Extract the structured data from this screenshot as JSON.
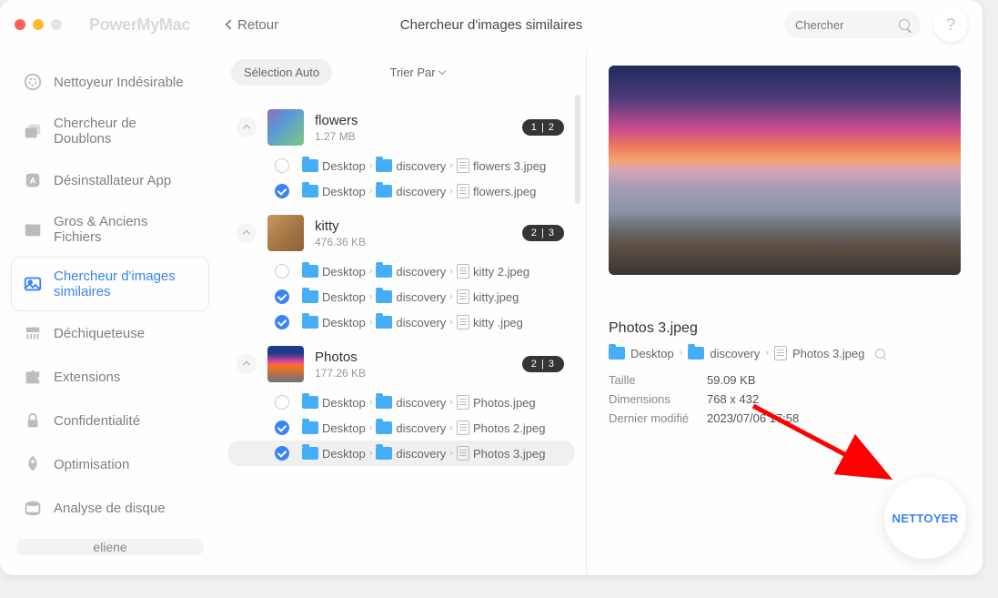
{
  "app_name": "PowerMyMac",
  "back_label": "Retour",
  "page_title": "Chercheur d'images similaires",
  "search_placeholder": "Chercher",
  "help_label": "?",
  "sidebar": {
    "items": [
      {
        "label": "Nettoyeur Indésirable"
      },
      {
        "label": "Chercheur de Doublons"
      },
      {
        "label": "Désinstallateur App"
      },
      {
        "label": "Gros & Anciens Fichiers"
      },
      {
        "label": "Chercheur d'images similaires"
      },
      {
        "label": "Déchiqueteuse"
      },
      {
        "label": "Extensions"
      },
      {
        "label": "Confidentialité"
      },
      {
        "label": "Optimisation"
      },
      {
        "label": "Analyse de disque"
      }
    ],
    "user": "eliene"
  },
  "toolbar": {
    "auto_select": "Sélection Auto",
    "sort": "Trier Par"
  },
  "path_labels": {
    "desktop": "Desktop",
    "discovery": "discovery"
  },
  "groups": [
    {
      "name": "flowers",
      "size": "1.27 MB",
      "badge": "1 | 2",
      "files": [
        {
          "checked": false,
          "name": "flowers 3.jpeg"
        },
        {
          "checked": true,
          "name": "flowers.jpeg"
        }
      ]
    },
    {
      "name": "kitty",
      "size": "476.36 KB",
      "badge": "2 | 3",
      "files": [
        {
          "checked": false,
          "name": "kitty 2.jpeg"
        },
        {
          "checked": true,
          "name": "kitty.jpeg"
        },
        {
          "checked": true,
          "name": "kitty .jpeg"
        }
      ]
    },
    {
      "name": "Photos",
      "size": "177.26 KB",
      "badge": "2 | 3",
      "files": [
        {
          "checked": false,
          "name": "Photos.jpeg"
        },
        {
          "checked": true,
          "name": "Photos 2.jpeg"
        },
        {
          "checked": true,
          "name": "Photos 3.jpeg",
          "selected": true
        }
      ]
    }
  ],
  "detail": {
    "filename": "Photos 3.jpeg",
    "path_file": "Photos 3.jpeg",
    "meta": {
      "size_label": "Taille",
      "size_val": "59.09 KB",
      "dim_label": "Dimensions",
      "dim_val": "768 x 432",
      "mod_label": "Dernier modifié",
      "mod_val": "2023/07/06 17:58"
    }
  },
  "clean_label": "NETTOYER"
}
